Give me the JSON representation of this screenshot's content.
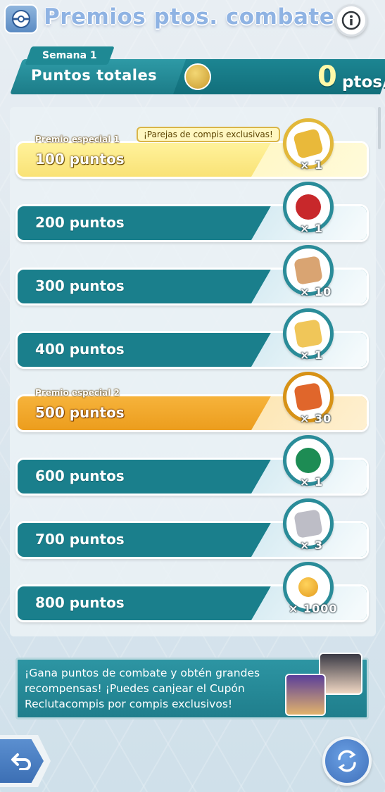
{
  "header": {
    "title": "Premios ptos. combate"
  },
  "totals": {
    "week": "Semana 1",
    "label": "Puntos totales",
    "value": "0",
    "unit": "ptos."
  },
  "rewards": [
    {
      "label": "100 puntos",
      "special": "Premio especial 1",
      "note": "¡Parejas de compis exclusivas!",
      "qty": "× 1",
      "style": "yellow",
      "item_color": "#e9b93a"
    },
    {
      "label": "200 puntos",
      "qty": "× 1",
      "style": "teal",
      "item_color": "#c8282b"
    },
    {
      "label": "300 puntos",
      "qty": "× 10",
      "style": "teal",
      "item_color": "#d9a472"
    },
    {
      "label": "400 puntos",
      "qty": "× 1",
      "style": "teal",
      "item_color": "#f0c659"
    },
    {
      "label": "500 puntos",
      "special": "Premio especial 2",
      "qty": "× 30",
      "style": "orange",
      "item_color": "#e0662b"
    },
    {
      "label": "600 puntos",
      "qty": "× 1",
      "style": "teal",
      "item_color": "#1d8c54"
    },
    {
      "label": "700 puntos",
      "qty": "× 3",
      "style": "teal",
      "item_color": "#bdbdc6"
    },
    {
      "label": "800 puntos",
      "qty": "× 1000",
      "style": "teal",
      "item_color": "#e39b1f"
    }
  ],
  "info": {
    "text": "¡Gana puntos de combate y obtén grandes recompensas! ¡Puedes canjear el Cupón Reclutacompis por compis exclusivos!"
  },
  "colors": {
    "teal": "#1a7f8c",
    "yellow": "#f9e276",
    "orange": "#ec9d1d",
    "title": "#8fb3e3"
  },
  "icons": {
    "logo": "pokeball-badge-icon",
    "info": "info-icon",
    "back": "back-arrow-icon",
    "swap": "swap-icon",
    "coin": "coin-icon"
  }
}
